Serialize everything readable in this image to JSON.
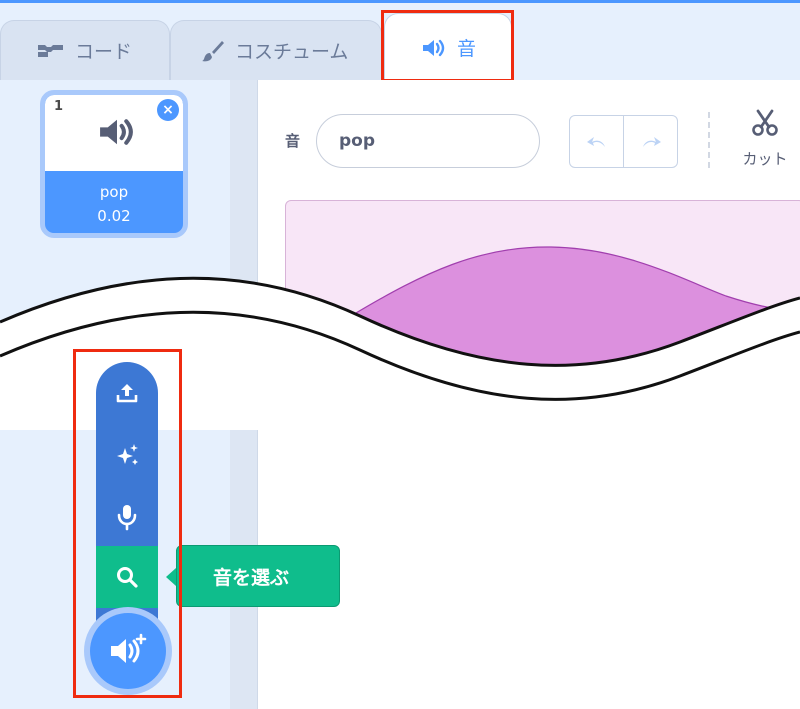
{
  "tabs": [
    {
      "label": "コード",
      "icon": "code-blocks-icon"
    },
    {
      "label": "コスチューム",
      "icon": "paintbrush-icon"
    },
    {
      "label": "音",
      "icon": "speaker-icon",
      "active": true
    }
  ],
  "sound_list": {
    "items": [
      {
        "index": "1",
        "name": "pop",
        "duration": "0.02",
        "selected": true
      }
    ]
  },
  "editor": {
    "sound_label": "音",
    "sound_name": "pop",
    "cut_label": "カット"
  },
  "add_sound_menu": {
    "items": [
      {
        "name": "upload",
        "icon": "upload-icon"
      },
      {
        "name": "surprise",
        "icon": "sparkle-icon"
      },
      {
        "name": "record",
        "icon": "microphone-icon"
      },
      {
        "name": "choose",
        "icon": "search-icon"
      }
    ],
    "main_icon": "add-sound-icon",
    "tooltip": "音を選ぶ"
  },
  "colors": {
    "accent": "#4c97ff",
    "menu": "#3d78d4",
    "choose": "#0fbd8c",
    "highlight": "#ef2b10",
    "waveform": "#dc90de"
  }
}
